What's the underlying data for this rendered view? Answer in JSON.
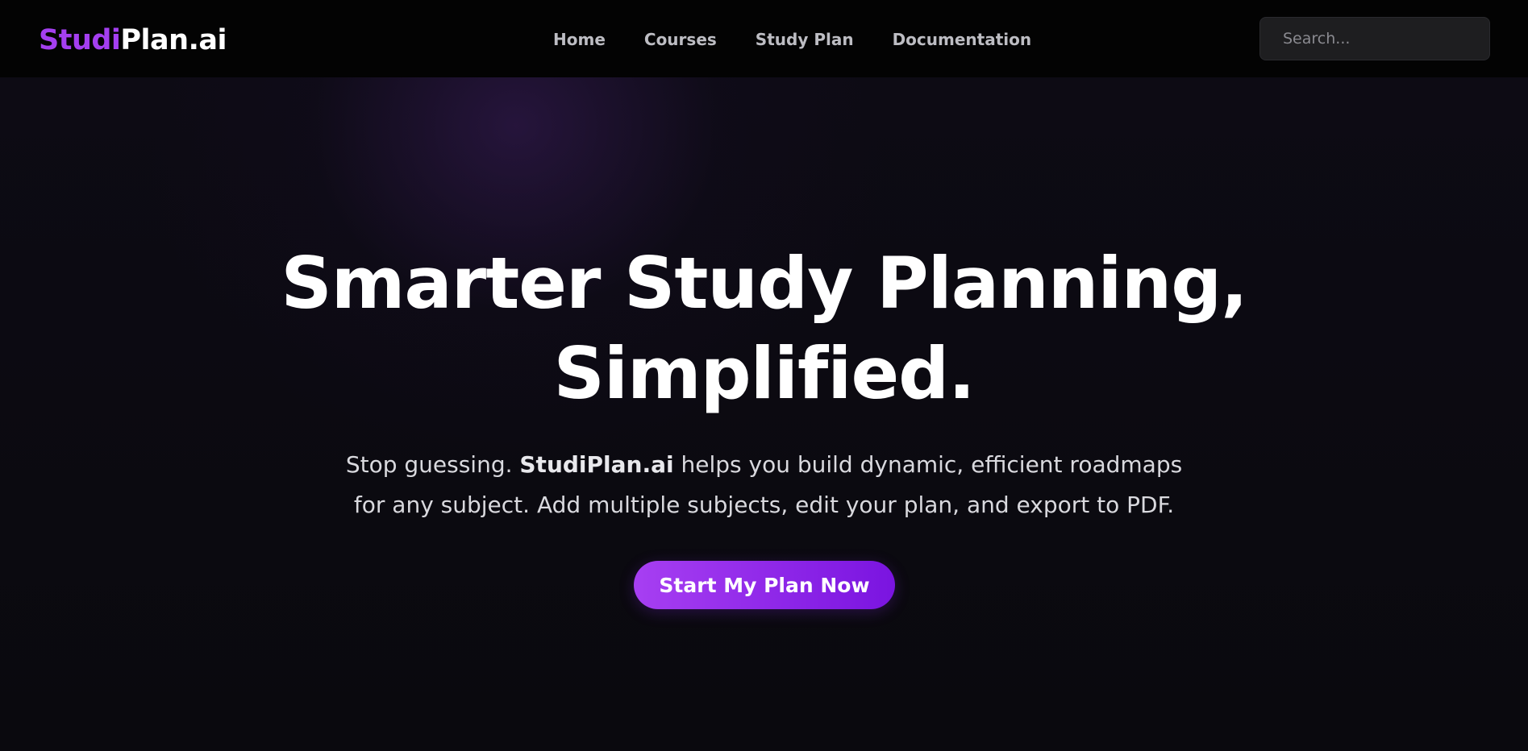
{
  "brand": {
    "logo_accent": "Studi",
    "logo_rest": "Plan.ai",
    "accent_color": "#a43ff0"
  },
  "nav": {
    "links": [
      {
        "label": "Home"
      },
      {
        "label": "Courses"
      },
      {
        "label": "Study Plan"
      },
      {
        "label": "Documentation"
      }
    ]
  },
  "search": {
    "placeholder": "Search..."
  },
  "hero": {
    "title_line1": "Smarter Study Planning,",
    "title_line2": "Simplified.",
    "subtitle_pre": "Stop guessing. ",
    "subtitle_brand": "StudiPlan.ai",
    "subtitle_post": " helps you build dynamic, efficient roadmaps for any subject. Add multiple subjects, edit your plan, and export to PDF.",
    "cta_label": "Start My Plan Now",
    "cta_gradient": [
      "#a73ff2",
      "#7a14e0"
    ]
  }
}
